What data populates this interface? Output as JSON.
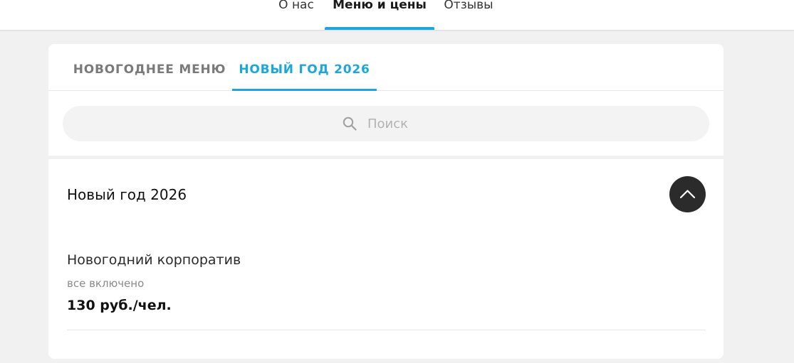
{
  "nav": {
    "items": [
      {
        "label": "О нас",
        "active": false
      },
      {
        "label": "Меню и цены",
        "active": true
      },
      {
        "label": "Отзывы",
        "active": false
      }
    ],
    "accent_color": "#1ca6e0"
  },
  "tabs": [
    {
      "label": "НОВОГОДНЕЕ МЕНЮ",
      "active": false
    },
    {
      "label": "НОВЫЙ ГОД 2026",
      "active": true
    }
  ],
  "search": {
    "placeholder": "Поиск",
    "value": "",
    "icon": "search-icon"
  },
  "section": {
    "title": "Новый год 2026",
    "collapse_icon": "chevron-up-icon",
    "items": [
      {
        "name": "Новогодний корпоратив",
        "description": "все включено",
        "price": "130 руб./чел."
      }
    ]
  }
}
